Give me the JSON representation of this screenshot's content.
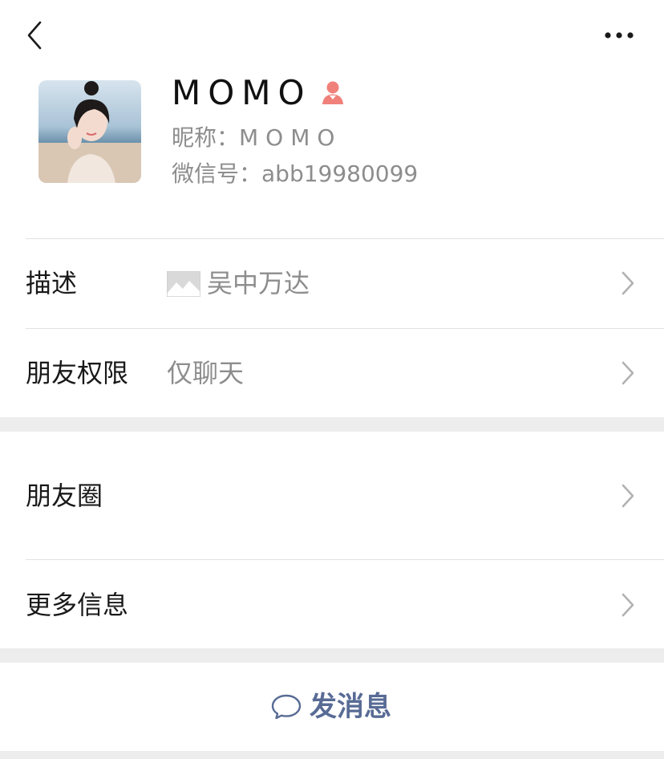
{
  "topbar": {
    "back_icon": "chevron-left-icon",
    "more_icon": "ellipsis-icon"
  },
  "profile": {
    "display_name": "MOMO",
    "gender_icon": "female-user-icon",
    "gender_color": "#f0817a",
    "nickname_label": "昵称：",
    "nickname_value": "MOMO",
    "wechat_id_label": "微信号：",
    "wechat_id_value": "abb19980099"
  },
  "rows": {
    "description": {
      "label": "描述",
      "value": "吴中万达",
      "icon": "image-icon"
    },
    "permissions": {
      "label": "朋友权限",
      "value": "仅聊天"
    },
    "moments": {
      "label": "朋友圈"
    },
    "more_info": {
      "label": "更多信息"
    }
  },
  "actions": {
    "send_message": {
      "label": "发消息",
      "icon": "chat-bubble-icon",
      "color": "#586b95"
    }
  }
}
